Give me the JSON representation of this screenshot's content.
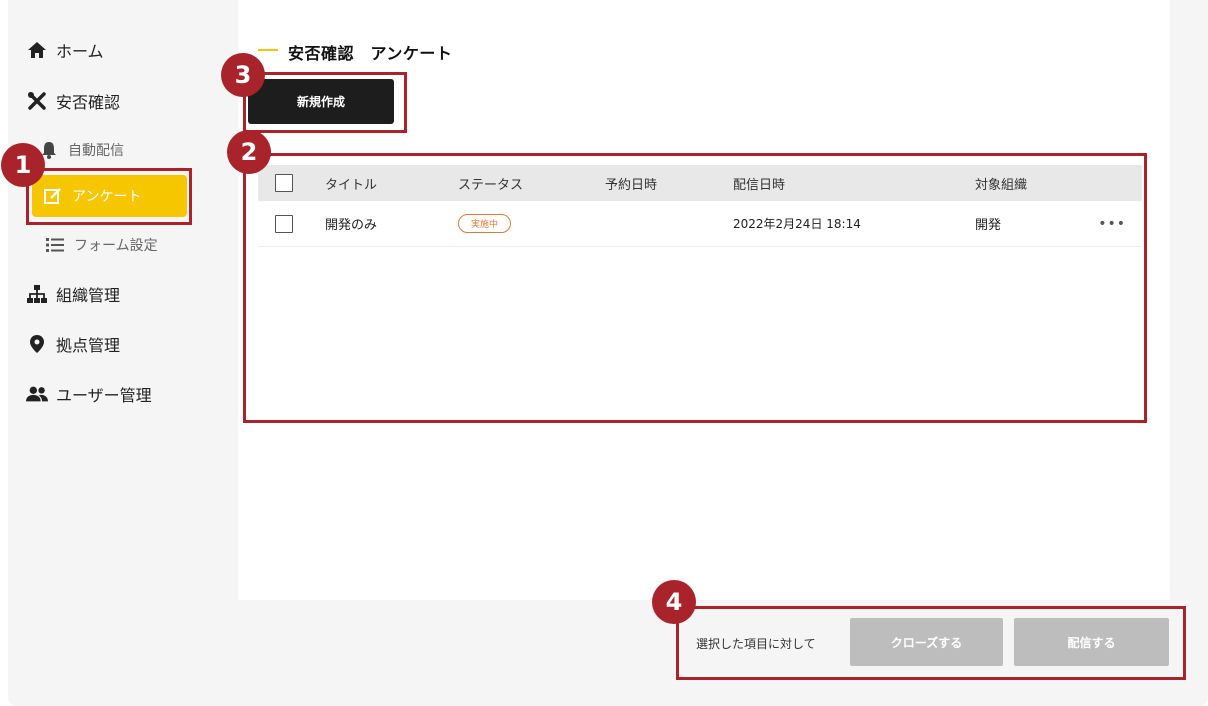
{
  "sidebar": {
    "items": [
      {
        "label": "ホーム",
        "icon": "home-icon"
      },
      {
        "label": "安否確認",
        "icon": "tools-icon"
      },
      {
        "label": "自動配信",
        "icon": "bell-icon"
      },
      {
        "label": "アンケート",
        "icon": "edit-icon"
      },
      {
        "label": "フォーム設定",
        "icon": "list-icon"
      },
      {
        "label": "組織管理",
        "icon": "org-chart-icon"
      },
      {
        "label": "拠点管理",
        "icon": "map-pin-icon"
      },
      {
        "label": "ユーザー管理",
        "icon": "users-icon"
      }
    ]
  },
  "page": {
    "title": "安否確認　アンケート",
    "new_button": "新規作成"
  },
  "table": {
    "headers": [
      "タイトル",
      "ステータス",
      "予約日時",
      "配信日時",
      "対象組織"
    ],
    "rows": [
      {
        "title": "開発のみ",
        "status": "実施中",
        "reserved": "",
        "delivered": "2022年2月24日 18:14",
        "org": "開発",
        "more": "•••"
      }
    ]
  },
  "bottom": {
    "label": "選択した項目に対して",
    "close_button": "クローズする",
    "send_button": "配信する"
  },
  "annotations": [
    "1",
    "2",
    "3",
    "4"
  ],
  "colors": {
    "accent": "#f6c600",
    "annotation": "#a8232a",
    "dark_button": "#1d1d1d"
  }
}
